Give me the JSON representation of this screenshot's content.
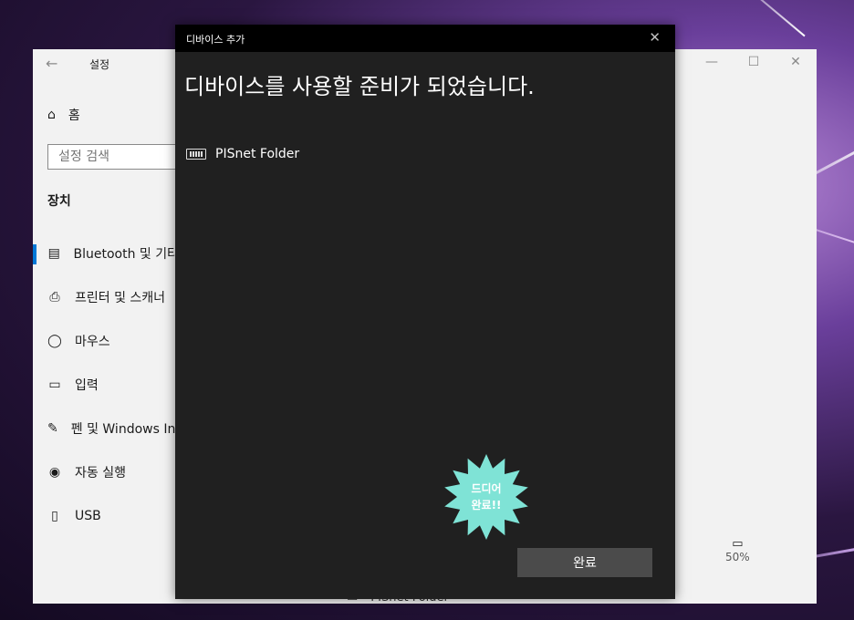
{
  "settings": {
    "title": "설정",
    "home_label": "홈",
    "search_placeholder": "설정 검색",
    "section_title": "장치",
    "nav": [
      {
        "label": "Bluetooth 및 기타",
        "icon": "bluetooth-devices-icon"
      },
      {
        "label": "프린터 및 스캐너",
        "icon": "printer-icon"
      },
      {
        "label": "마우스",
        "icon": "mouse-icon"
      },
      {
        "label": "입력",
        "icon": "keyboard-icon"
      },
      {
        "label": "펜 및 Windows Ink",
        "icon": "pen-icon"
      },
      {
        "label": "자동 실행",
        "icon": "autoplay-icon"
      },
      {
        "label": "USB",
        "icon": "usb-icon"
      }
    ],
    "battery_percent": "50%",
    "partial_device": "PISnet Folder"
  },
  "dialog": {
    "title": "디바이스 추가",
    "heading": "디바이스를 사용할 준비가 되었습니다.",
    "device_name": "PISnet Folder",
    "done_label": "완료",
    "sticker_line1": "드디어",
    "sticker_line2": "완료!!",
    "sticker_color": "#7fe3d6"
  }
}
